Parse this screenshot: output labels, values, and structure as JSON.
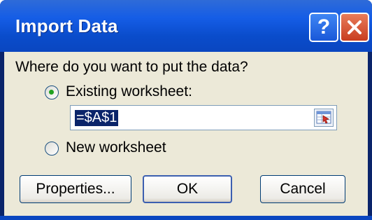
{
  "window": {
    "title": "Import Data"
  },
  "titlebar_buttons": {
    "help_label": "?",
    "help_icon": "help-icon",
    "close_icon": "close-icon"
  },
  "dialog": {
    "prompt": "Where do you want to put the data?",
    "options": [
      {
        "label": "Existing worksheet:",
        "selected": true
      },
      {
        "label": "New worksheet",
        "selected": false
      }
    ],
    "range_value": "=$A$1",
    "ref_icon": "collapse-dialog-icon"
  },
  "buttons": {
    "properties": "Properties...",
    "ok": "OK",
    "cancel": "Cancel"
  },
  "colors": {
    "titlebar": "#0a4ccb",
    "client": "#ece9d8",
    "selection": "#0a246a"
  }
}
